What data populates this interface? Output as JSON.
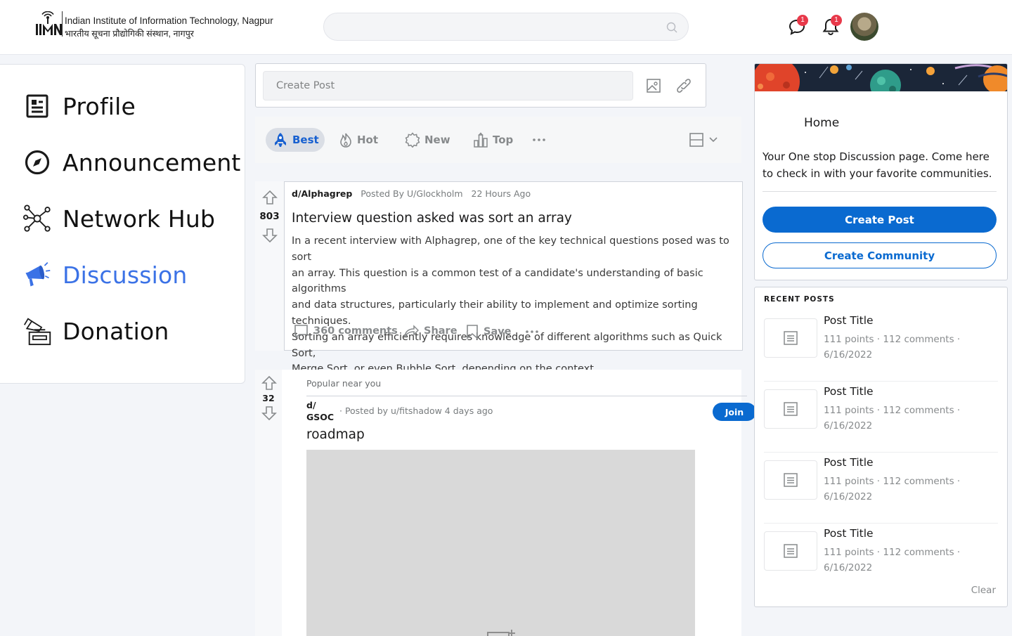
{
  "header": {
    "institute_name": "Indian Institute of Information Technology, Nagpur",
    "institute_name_hindi": "भारतीय सूचना प्रौद्योगिकी संस्थान, नागपुर",
    "search_placeholder": "",
    "messages_badge": "1",
    "notifications_badge": "1"
  },
  "nav": {
    "items": [
      {
        "label": "Profile",
        "icon": "profile-icon"
      },
      {
        "label": "Announcement",
        "icon": "compass-icon"
      },
      {
        "label": "Network Hub",
        "icon": "network-icon"
      },
      {
        "label": "Discussion",
        "icon": "megaphone-icon",
        "active": true
      },
      {
        "label": "Donation",
        "icon": "donation-icon"
      }
    ]
  },
  "create_post": {
    "placeholder": "Create Post"
  },
  "sort": {
    "best": "Best",
    "hot": "Hot",
    "new": "New",
    "top": "Top"
  },
  "post1": {
    "votes": "803",
    "community": "d/Alphagrep",
    "posted_by": "Posted By",
    "author": "U/Glockholm",
    "time": "22 Hours Ago",
    "title": "Interview question asked was sort an array",
    "body_lines": [
      "In a recent interview with Alphagrep, one of the key technical questions posed was to sort",
      "an array. This question is a common test of a candidate's understanding of basic algorithms",
      "and data structures, particularly their ability to implement and optimize sorting techniques.",
      "Sorting an array efficiently requires knowledge of different algorithms such as Quick Sort,",
      "Merge Sort, or even Bubble Sort, depending on the context."
    ],
    "comments": "360 comments",
    "share": "Share",
    "save": "Save"
  },
  "post2": {
    "votes": "32",
    "label": "Popular near you",
    "community_line1": "d/",
    "community_line2": "GSOC",
    "meta": "· Posted by u/fitshadow 4 days ago",
    "join": "Join",
    "title": "roadmap"
  },
  "home_card": {
    "title": "Home",
    "description": "Your One stop Discussion page. Come here to check in with your favorite communities.",
    "create_post": "Create Post",
    "create_community": "Create Community"
  },
  "recent": {
    "heading": "RECENT POSTS",
    "items": [
      {
        "title": "Post Title",
        "meta_line1": "111 points · 112 comments ·",
        "meta_line2": "6/16/2022"
      },
      {
        "title": "Post Title",
        "meta_line1": "111 points · 112 comments ·",
        "meta_line2": "6/16/2022"
      },
      {
        "title": "Post Title",
        "meta_line1": "111 points · 112 comments ·",
        "meta_line2": "6/16/2022"
      },
      {
        "title": "Post Title",
        "meta_line1": "111 points · 112 comments ·",
        "meta_line2": "6/16/2022"
      }
    ],
    "clear": "Clear"
  },
  "colors": {
    "accent": "#0a6ad0",
    "nav_active": "#3b72e6",
    "badge": "#e8394a"
  }
}
